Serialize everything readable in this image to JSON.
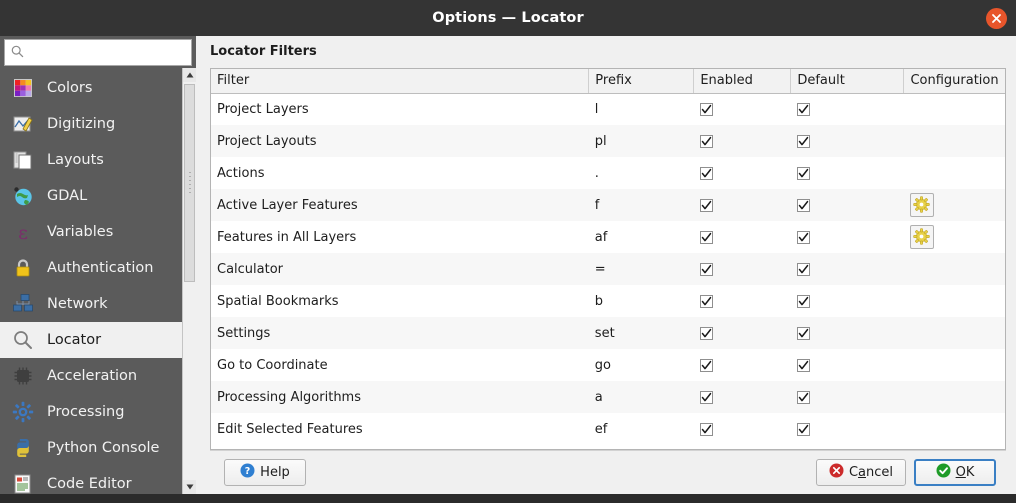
{
  "window": {
    "title": "Options — Locator",
    "close_icon": "close-icon"
  },
  "sidebar": {
    "search": {
      "value": "",
      "placeholder": "",
      "icon": "search-icon"
    },
    "items": [
      {
        "label": "Colors",
        "icon": "color-palette-icon",
        "selected": false
      },
      {
        "label": "Digitizing",
        "icon": "digitizing-icon",
        "selected": false
      },
      {
        "label": "Layouts",
        "icon": "layouts-icon",
        "selected": false
      },
      {
        "label": "GDAL",
        "icon": "globe-icon",
        "selected": false
      },
      {
        "label": "Variables",
        "icon": "epsilon-icon",
        "selected": false
      },
      {
        "label": "Authentication",
        "icon": "lock-icon",
        "selected": false
      },
      {
        "label": "Network",
        "icon": "network-icon",
        "selected": false
      },
      {
        "label": "Locator",
        "icon": "search-icon",
        "selected": true
      },
      {
        "label": "Acceleration",
        "icon": "cpu-chip-icon",
        "selected": false
      },
      {
        "label": "Processing",
        "icon": "gear-icon",
        "selected": false
      },
      {
        "label": "Python Console",
        "icon": "python-icon",
        "selected": false
      },
      {
        "label": "Code Editor",
        "icon": "code-editor-icon",
        "selected": false
      }
    ]
  },
  "main": {
    "section_title": "Locator Filters",
    "table": {
      "columns": [
        "Filter",
        "Prefix",
        "Enabled",
        "Default",
        "Configuration"
      ],
      "rows": [
        {
          "filter": "Project Layers",
          "prefix": "l",
          "enabled": true,
          "default": true,
          "configuration": false
        },
        {
          "filter": "Project Layouts",
          "prefix": "pl",
          "enabled": true,
          "default": true,
          "configuration": false
        },
        {
          "filter": "Actions",
          "prefix": ".",
          "enabled": true,
          "default": true,
          "configuration": false
        },
        {
          "filter": "Active Layer Features",
          "prefix": "f",
          "enabled": true,
          "default": true,
          "configuration": true
        },
        {
          "filter": "Features in All Layers",
          "prefix": "af",
          "enabled": true,
          "default": true,
          "configuration": true
        },
        {
          "filter": "Calculator",
          "prefix": "=",
          "enabled": true,
          "default": true,
          "configuration": false
        },
        {
          "filter": "Spatial Bookmarks",
          "prefix": "b",
          "enabled": true,
          "default": true,
          "configuration": false
        },
        {
          "filter": "Settings",
          "prefix": "set",
          "enabled": true,
          "default": true,
          "configuration": false
        },
        {
          "filter": "Go to Coordinate",
          "prefix": "go",
          "enabled": true,
          "default": true,
          "configuration": false
        },
        {
          "filter": "Processing Algorithms",
          "prefix": "a",
          "enabled": true,
          "default": true,
          "configuration": false
        },
        {
          "filter": "Edit Selected Features",
          "prefix": "ef",
          "enabled": true,
          "default": true,
          "configuration": false
        }
      ]
    }
  },
  "buttons": {
    "help": {
      "label": "Help",
      "icon": "help-question-icon",
      "focused": false
    },
    "cancel": {
      "label_pre": "C",
      "label_accel": "a",
      "label_post": "ncel",
      "icon": "cancel-x-icon",
      "focused": false
    },
    "ok": {
      "label_accel": "O",
      "label_post": "K",
      "icon": "ok-check-icon",
      "focused": true
    }
  },
  "colors": {
    "titlebar_bg": "#343434",
    "close_btn": "#e8552b",
    "sidebar_bg": "#5b5b5b",
    "sidebar_selected_bg": "#f0f0f0",
    "content_bg": "#f0f0f0",
    "table_bg": "#ffffff",
    "table_alt_row": "#f7f7f7",
    "gear_yellow": "#e8d24a",
    "ok_green": "#1f9b28",
    "cancel_red": "#cc2b2b",
    "help_blue": "#2f7fd1",
    "focus_blue": "#3a7fc4"
  }
}
